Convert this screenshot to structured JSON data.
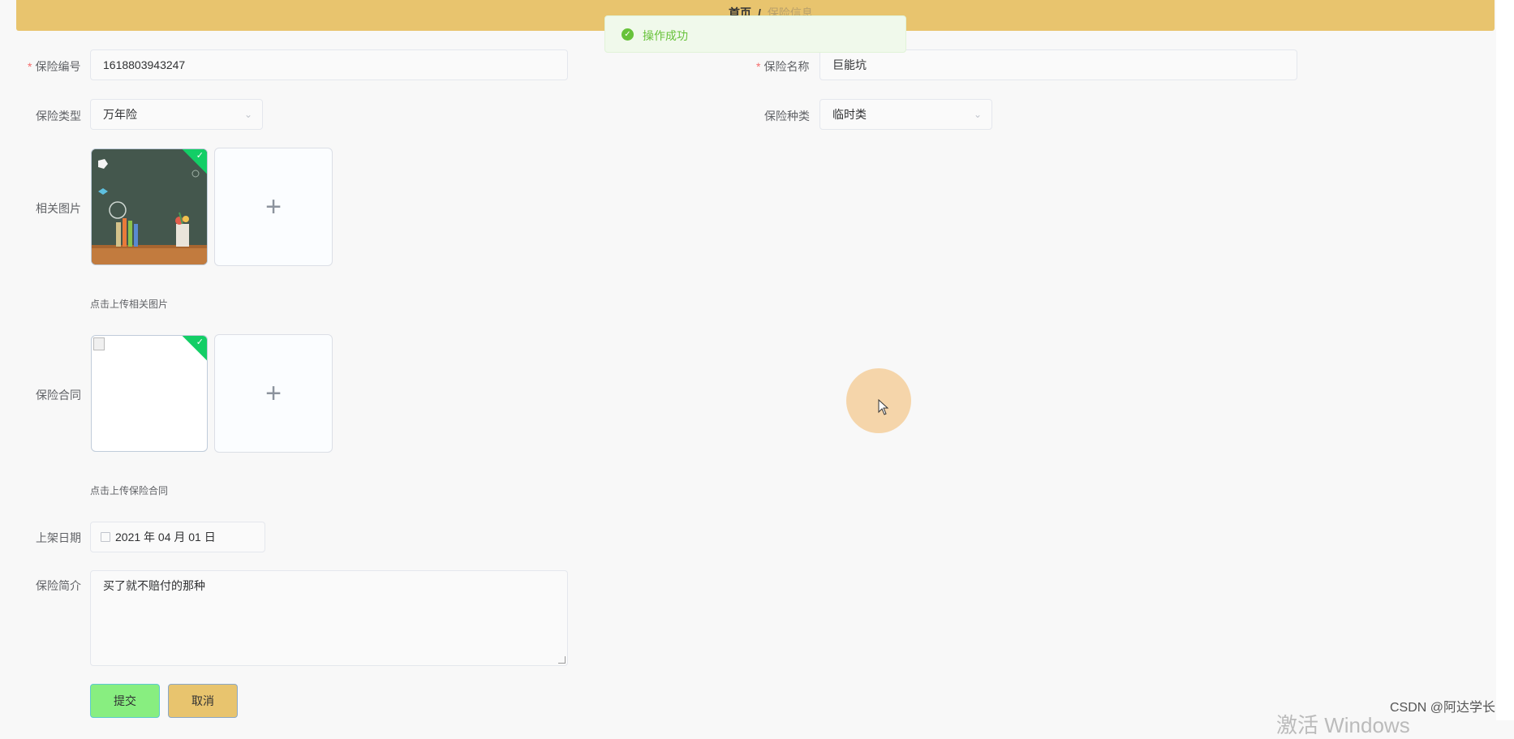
{
  "breadcrumb": {
    "home": "首页",
    "separator": "/",
    "current": "保险信息"
  },
  "toast": {
    "message": "操作成功",
    "icon": "success-check-icon"
  },
  "form": {
    "insurance_no": {
      "label": "保险编号",
      "value": "1618803943247",
      "required": true
    },
    "insurance_name": {
      "label": "保险名称",
      "value": "巨能坑",
      "required": true
    },
    "insurance_type": {
      "label": "保险类型",
      "value": "万年险"
    },
    "insurance_kind": {
      "label": "保险种类",
      "value": "临时类"
    },
    "images": {
      "label": "相关图片",
      "hint": "点击上传相关图片",
      "add_symbol": "+"
    },
    "contract": {
      "label": "保险合同",
      "hint": "点击上传保险合同",
      "add_symbol": "+"
    },
    "shelf_date": {
      "label": "上架日期",
      "value": "2021 年 04 月 01 日"
    },
    "intro": {
      "label": "保险简介",
      "value": "买了就不赔付的那种"
    }
  },
  "buttons": {
    "submit": "提交",
    "cancel": "取消"
  },
  "overlay": {
    "watermark": "CSDN @阿达学长",
    "windows_activation": "激活 Windows"
  },
  "colors": {
    "topbar": "#e8c46e",
    "submit": "#88ee80",
    "cancel": "#e8c46e",
    "success": "#67c23a"
  }
}
